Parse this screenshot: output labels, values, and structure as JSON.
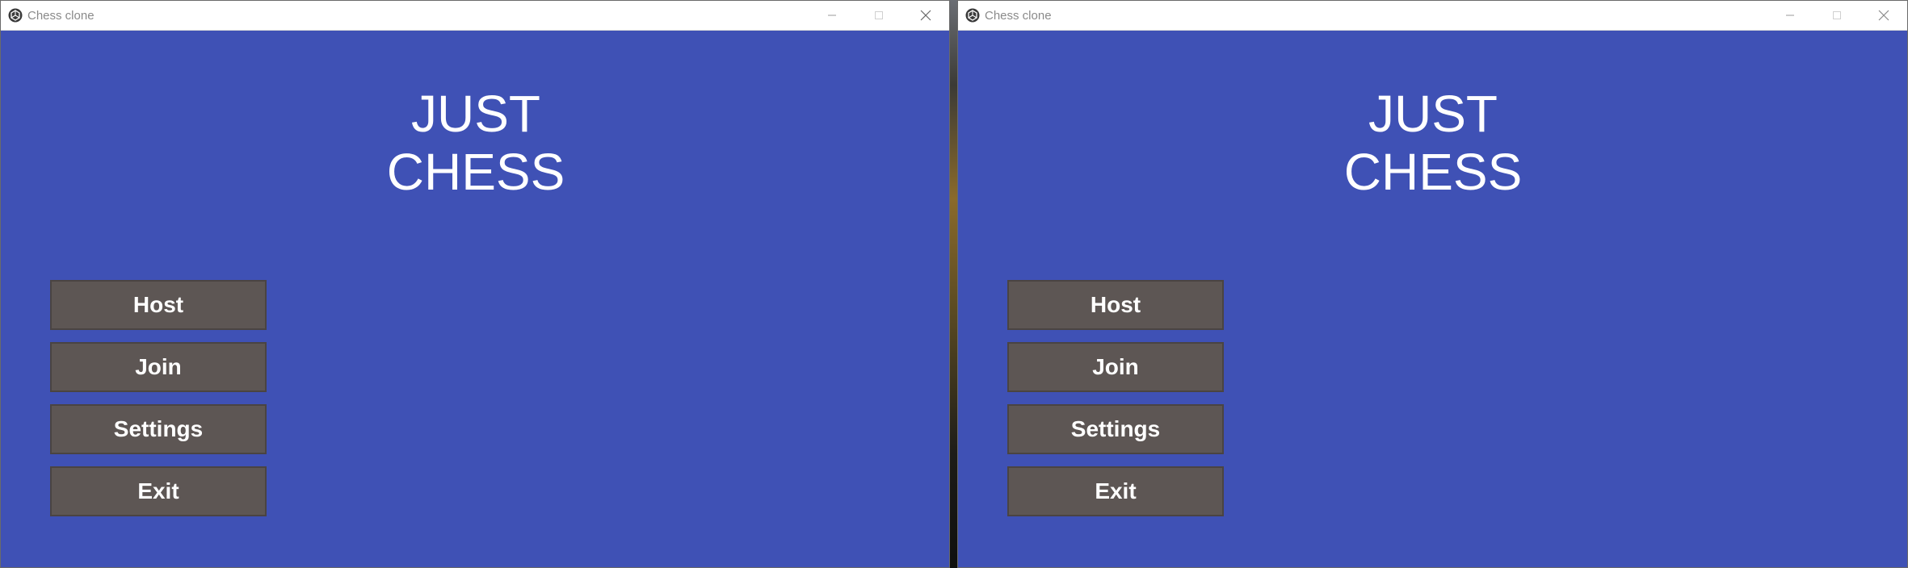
{
  "windows": [
    {
      "title": "Chess clone",
      "game_title_line1": "JUST",
      "game_title_line2": "CHESS",
      "menu": {
        "host": "Host",
        "join": "Join",
        "settings": "Settings",
        "exit": "Exit"
      }
    },
    {
      "title": "Chess clone",
      "game_title_line1": "JUST",
      "game_title_line2": "CHESS",
      "menu": {
        "host": "Host",
        "join": "Join",
        "settings": "Settings",
        "exit": "Exit"
      }
    }
  ],
  "icons": {
    "app": "unity-app-icon",
    "minimize": "minimize-icon",
    "maximize": "maximize-icon",
    "close": "close-icon"
  },
  "colors": {
    "background": "#3f51b5",
    "button": "#5d5654",
    "text": "#ffffff",
    "titlebar": "#ffffff"
  }
}
